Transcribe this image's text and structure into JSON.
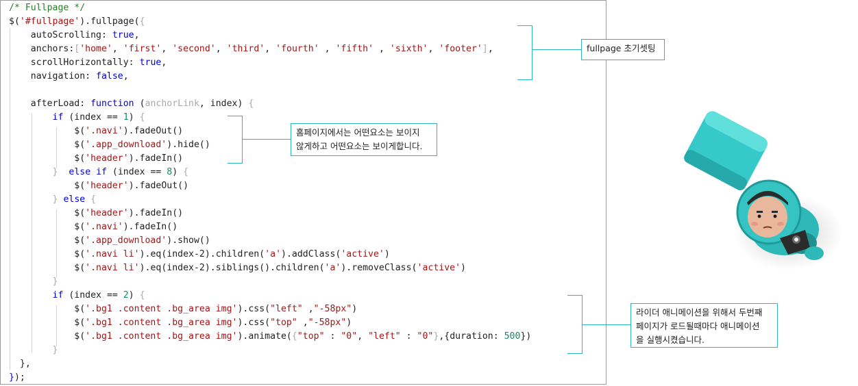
{
  "code": {
    "l1": "/* Fullpage */",
    "l2a": "$(",
    "l2b": "'#fullpage'",
    "l2c": ").fullpage(",
    "l2d": "{",
    "l3a": "    autoScrolling: ",
    "l3b": "true",
    "l3c": ",",
    "l4a": "    anchors:",
    "l4b": "[",
    "l4c": "'home'",
    "l4d": ", ",
    "l4e": "'first'",
    "l4f": ", ",
    "l4g": "'second'",
    "l4h": ", ",
    "l4i": "'third'",
    "l4j": ", ",
    "l4k": "'fourth'",
    "l4l": " , ",
    "l4m": "'fifth'",
    "l4n": " , ",
    "l4o": "'sixth'",
    "l4p": ", ",
    "l4q": "'footer'",
    "l4r": "]",
    "l4s": ",",
    "l5a": "    scrollHorizontally: ",
    "l5b": "true",
    "l5c": ",",
    "l6a": "    navigation: ",
    "l6b": "false",
    "l6c": ",",
    "l8a": "    afterLoad: ",
    "l8b": "function",
    "l8c": " (",
    "l8d": "anchorLink",
    "l8e": ", index) ",
    "l8f": "{",
    "l9a": "        ",
    "l9b": "if",
    "l9c": " (index == ",
    "l9d": "1",
    "l9e": ") ",
    "l9f": "{",
    "l10a": "            $(",
    "l10b": "'.navi'",
    "l10c": ").fadeOut()",
    "l11a": "            $(",
    "l11b": "'.app_download'",
    "l11c": ").hide()",
    "l12a": "            $(",
    "l12b": "'header'",
    "l12c": ").fadeIn()",
    "l13a": "        ",
    "l13b": "}",
    "l13c": "  ",
    "l13d": "else if",
    "l13e": " (index == ",
    "l13f": "8",
    "l13g": ") ",
    "l13h": "{",
    "l14a": "            $(",
    "l14b": "'header'",
    "l14c": ").fadeOut()",
    "l15a": "        ",
    "l15b": "}",
    "l15c": " ",
    "l15d": "else",
    "l15e": " ",
    "l15f": "{",
    "l16a": "            $(",
    "l16b": "'header'",
    "l16c": ").fadeIn()",
    "l17a": "            $(",
    "l17b": "'.navi'",
    "l17c": ").fadeIn()",
    "l18a": "            $(",
    "l18b": "'.app_download'",
    "l18c": ").show()",
    "l19a": "            $(",
    "l19b": "'.navi li'",
    "l19c": ").eq(index-2).children(",
    "l19d": "'a'",
    "l19e": ").addClass(",
    "l19f": "'active'",
    "l19g": ")",
    "l20a": "            $(",
    "l20b": "'.navi li'",
    "l20c": ").eq(index-2).siblings().children(",
    "l20d": "'a'",
    "l20e": ").removeClass(",
    "l20f": "'active'",
    "l20g": ")",
    "l21a": "        ",
    "l21b": "}",
    "l22a": "        ",
    "l22b": "if",
    "l22c": " (index == ",
    "l22d": "2",
    "l22e": ") ",
    "l22f": "{",
    "l23a": "            $(",
    "l23b": "'.bg1 .content .bg_area img'",
    "l23c": ").css(",
    "l23d": "\"left\"",
    "l23e": " ,",
    "l23f": "\"-58px\"",
    "l23g": ")",
    "l24a": "            $(",
    "l24b": "'.bg1 .content .bg_area img'",
    "l24c": ").css(",
    "l24d": "\"top\"",
    "l24e": " ,",
    "l24f": "\"-58px\"",
    "l24g": ")",
    "l25a": "            $(",
    "l25b": "'.bg1 .content .bg_area img'",
    "l25c": ").animate(",
    "l25d": "{",
    "l25e": "\"top\"",
    "l25f": " : ",
    "l25g": "\"0\"",
    "l25h": ", ",
    "l25i": "\"left\"",
    "l25j": " : ",
    "l25k": "\"0\"",
    "l25l": "}",
    "l25m": ",{duration: ",
    "l25n": "500",
    "l25o": "})",
    "l26a": "        ",
    "l26b": "}",
    "l27": "  },",
    "l28a": "}",
    "l28b": ");"
  },
  "annotations": {
    "note1": "fullpage 초기셋팅",
    "note2_line1": "홈페이지에서는 어떤요소는 보이지",
    "note2_line2": "않게하고 어떤요소는 보이게합니다.",
    "note3_line1": "라이더 애니메이션을 위해서 두번째",
    "note3_line2": "페이지가 로드될때마다 애니메이션",
    "note3_line3": "을 실행시켰습니다."
  },
  "colors": {
    "accent": "#2bb5c0",
    "keyword": "#0000d8",
    "string": "#a31515",
    "comment": "#2d7a2d"
  },
  "figure": {
    "icon": "rider-character-figurine-icon"
  }
}
